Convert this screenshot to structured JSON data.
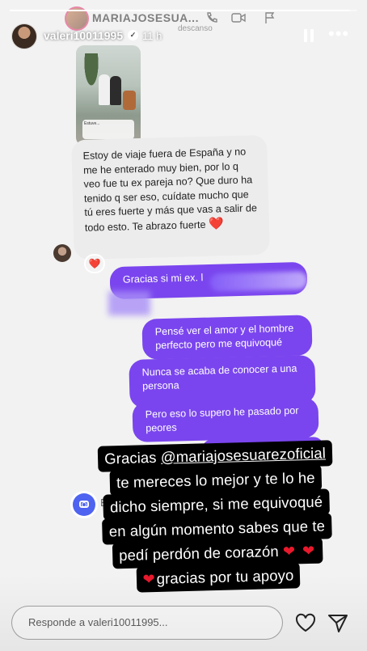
{
  "story": {
    "username": "valeri10011995",
    "time": "11 h",
    "progress": 0.98
  },
  "dm": {
    "name": "MARIAJOSESUA...",
    "status": "descanso"
  },
  "photo_caption": "Estuve... ",
  "received_message": "Estoy de viaje fuera de España y no me he enterado muy bien, por lo q veo fue tu ex pareja no? Que duro ha tenido q ser eso, cuídate mucho que tú eres fuerte y más que vas a salir de todo esto. Te abrazo fuerte",
  "received_heart": "❤️",
  "reaction": "❤️",
  "sent_messages": [
    "Gracias si mi ex. l",
    "Pensé ver el amor y el hombre perfecto pero me equivoqué",
    "Nunca se acaba de conocer a una persona",
    "Pero eso lo supero he pasado por peores"
  ],
  "camera_hint": "E",
  "caption": {
    "line1_prefix": "Gracias ",
    "mention": "@mariajosesuarezoficial",
    "line2": "te mereces lo mejor y te lo he",
    "line3": "dicho siempre, si me equivoqué",
    "line4": "en algún momento sabes que te",
    "line5": "pedí perdón de corazón",
    "line5_hearts": "❤ ❤",
    "line6_heart": "❤",
    "line6": "gracias por tu apoyo"
  },
  "reply": {
    "placeholder": "Responde a valeri10011995..."
  },
  "icons": {
    "like": "heart-outline-icon",
    "send": "send-icon",
    "pause": "pause-icon",
    "more": "more-dots-icon"
  },
  "colors": {
    "sent_bubble": "#7a45ee",
    "heart": "#e8192c",
    "camera": "#4e63f0"
  }
}
